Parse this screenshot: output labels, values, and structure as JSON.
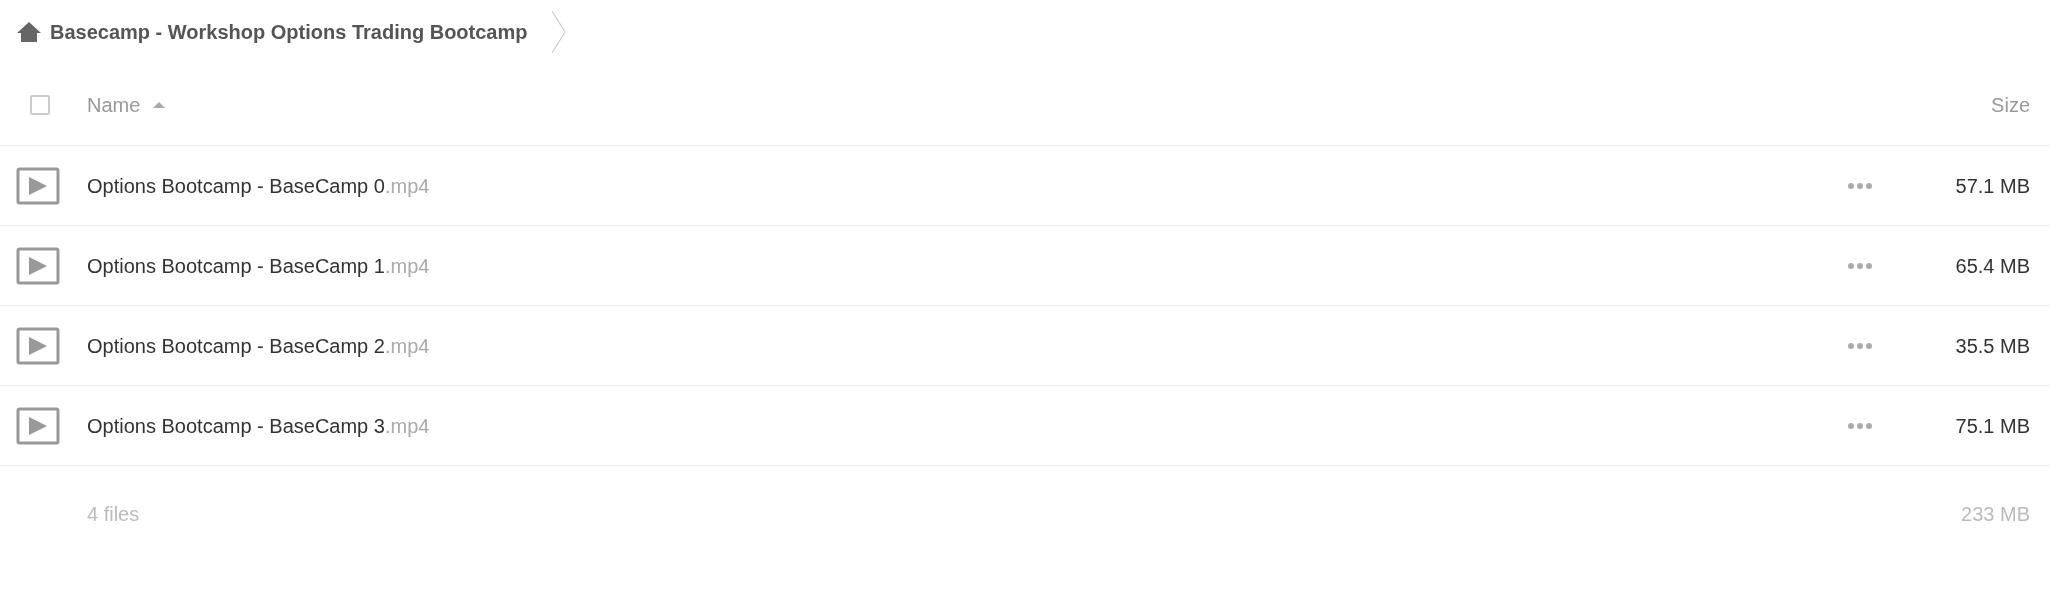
{
  "breadcrumb": {
    "title": "Basecamp - Workshop Options Trading Bootcamp"
  },
  "table": {
    "select_all": {
      "checked": false
    },
    "columns": [
      {
        "label": "Name",
        "sorted": true
      },
      {
        "label": "Size",
        "sorted": false
      }
    ],
    "rows": [
      {
        "name": "Options Bootcamp - BaseCamp 0",
        "extension": ".mp4",
        "size": "57.1 MB"
      },
      {
        "name": "Options Bootcamp - BaseCamp 1",
        "extension": ".mp4",
        "size": "65.4 MB"
      },
      {
        "name": "Options Bootcamp - BaseCamp 2",
        "extension": ".mp4",
        "size": "35.5 MB"
      },
      {
        "name": "Options Bootcamp - BaseCamp 3",
        "extension": ".mp4",
        "size": "75.1 MB"
      }
    ]
  },
  "summary": {
    "count": "4 files",
    "total": "233 MB"
  }
}
